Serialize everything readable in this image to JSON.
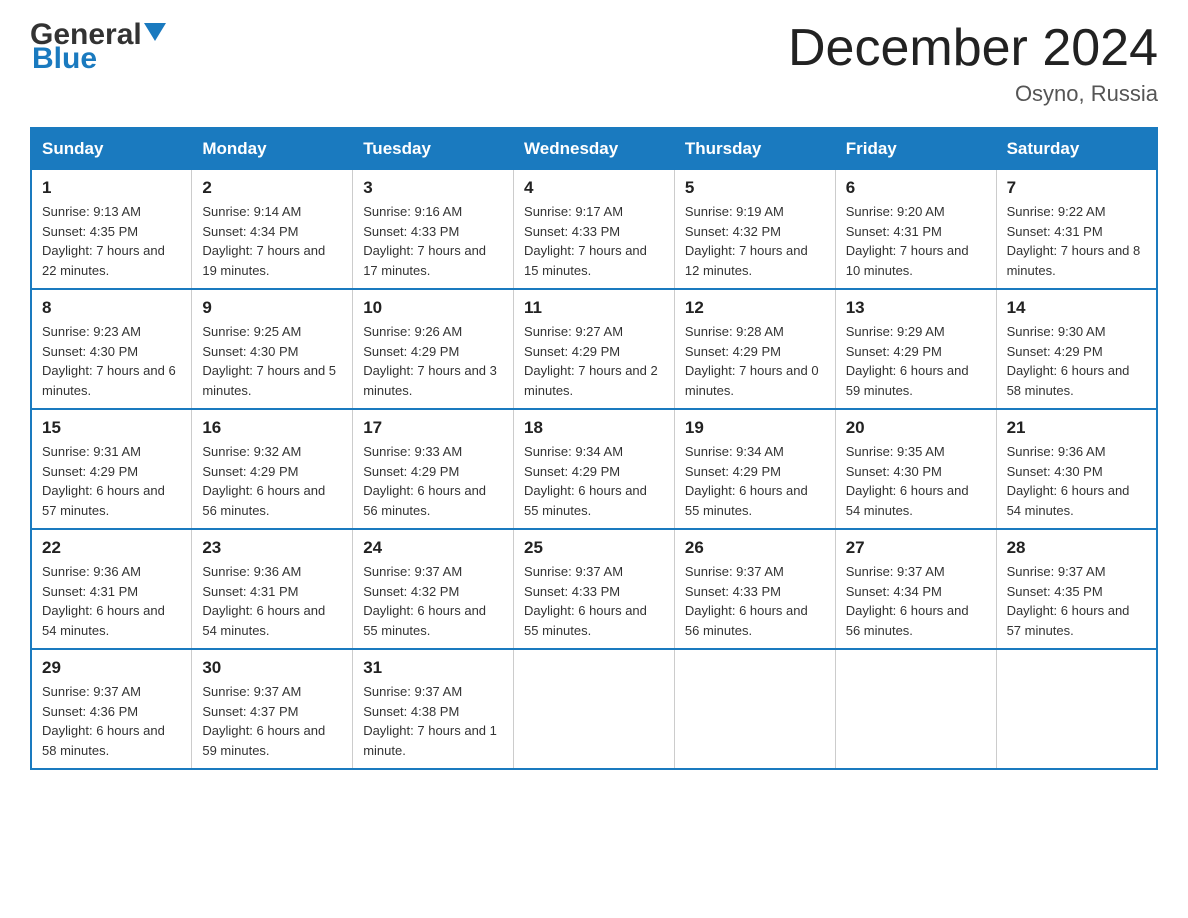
{
  "header": {
    "logo_general": "General",
    "logo_blue": "Blue",
    "month_title": "December 2024",
    "location": "Osyno, Russia"
  },
  "days_of_week": [
    "Sunday",
    "Monday",
    "Tuesday",
    "Wednesday",
    "Thursday",
    "Friday",
    "Saturday"
  ],
  "weeks": [
    [
      {
        "day": "1",
        "sunrise": "9:13 AM",
        "sunset": "4:35 PM",
        "daylight": "7 hours and 22 minutes."
      },
      {
        "day": "2",
        "sunrise": "9:14 AM",
        "sunset": "4:34 PM",
        "daylight": "7 hours and 19 minutes."
      },
      {
        "day": "3",
        "sunrise": "9:16 AM",
        "sunset": "4:33 PM",
        "daylight": "7 hours and 17 minutes."
      },
      {
        "day": "4",
        "sunrise": "9:17 AM",
        "sunset": "4:33 PM",
        "daylight": "7 hours and 15 minutes."
      },
      {
        "day": "5",
        "sunrise": "9:19 AM",
        "sunset": "4:32 PM",
        "daylight": "7 hours and 12 minutes."
      },
      {
        "day": "6",
        "sunrise": "9:20 AM",
        "sunset": "4:31 PM",
        "daylight": "7 hours and 10 minutes."
      },
      {
        "day": "7",
        "sunrise": "9:22 AM",
        "sunset": "4:31 PM",
        "daylight": "7 hours and 8 minutes."
      }
    ],
    [
      {
        "day": "8",
        "sunrise": "9:23 AM",
        "sunset": "4:30 PM",
        "daylight": "7 hours and 6 minutes."
      },
      {
        "day": "9",
        "sunrise": "9:25 AM",
        "sunset": "4:30 PM",
        "daylight": "7 hours and 5 minutes."
      },
      {
        "day": "10",
        "sunrise": "9:26 AM",
        "sunset": "4:29 PM",
        "daylight": "7 hours and 3 minutes."
      },
      {
        "day": "11",
        "sunrise": "9:27 AM",
        "sunset": "4:29 PM",
        "daylight": "7 hours and 2 minutes."
      },
      {
        "day": "12",
        "sunrise": "9:28 AM",
        "sunset": "4:29 PM",
        "daylight": "7 hours and 0 minutes."
      },
      {
        "day": "13",
        "sunrise": "9:29 AM",
        "sunset": "4:29 PM",
        "daylight": "6 hours and 59 minutes."
      },
      {
        "day": "14",
        "sunrise": "9:30 AM",
        "sunset": "4:29 PM",
        "daylight": "6 hours and 58 minutes."
      }
    ],
    [
      {
        "day": "15",
        "sunrise": "9:31 AM",
        "sunset": "4:29 PM",
        "daylight": "6 hours and 57 minutes."
      },
      {
        "day": "16",
        "sunrise": "9:32 AM",
        "sunset": "4:29 PM",
        "daylight": "6 hours and 56 minutes."
      },
      {
        "day": "17",
        "sunrise": "9:33 AM",
        "sunset": "4:29 PM",
        "daylight": "6 hours and 56 minutes."
      },
      {
        "day": "18",
        "sunrise": "9:34 AM",
        "sunset": "4:29 PM",
        "daylight": "6 hours and 55 minutes."
      },
      {
        "day": "19",
        "sunrise": "9:34 AM",
        "sunset": "4:29 PM",
        "daylight": "6 hours and 55 minutes."
      },
      {
        "day": "20",
        "sunrise": "9:35 AM",
        "sunset": "4:30 PM",
        "daylight": "6 hours and 54 minutes."
      },
      {
        "day": "21",
        "sunrise": "9:36 AM",
        "sunset": "4:30 PM",
        "daylight": "6 hours and 54 minutes."
      }
    ],
    [
      {
        "day": "22",
        "sunrise": "9:36 AM",
        "sunset": "4:31 PM",
        "daylight": "6 hours and 54 minutes."
      },
      {
        "day": "23",
        "sunrise": "9:36 AM",
        "sunset": "4:31 PM",
        "daylight": "6 hours and 54 minutes."
      },
      {
        "day": "24",
        "sunrise": "9:37 AM",
        "sunset": "4:32 PM",
        "daylight": "6 hours and 55 minutes."
      },
      {
        "day": "25",
        "sunrise": "9:37 AM",
        "sunset": "4:33 PM",
        "daylight": "6 hours and 55 minutes."
      },
      {
        "day": "26",
        "sunrise": "9:37 AM",
        "sunset": "4:33 PM",
        "daylight": "6 hours and 56 minutes."
      },
      {
        "day": "27",
        "sunrise": "9:37 AM",
        "sunset": "4:34 PM",
        "daylight": "6 hours and 56 minutes."
      },
      {
        "day": "28",
        "sunrise": "9:37 AM",
        "sunset": "4:35 PM",
        "daylight": "6 hours and 57 minutes."
      }
    ],
    [
      {
        "day": "29",
        "sunrise": "9:37 AM",
        "sunset": "4:36 PM",
        "daylight": "6 hours and 58 minutes."
      },
      {
        "day": "30",
        "sunrise": "9:37 AM",
        "sunset": "4:37 PM",
        "daylight": "6 hours and 59 minutes."
      },
      {
        "day": "31",
        "sunrise": "9:37 AM",
        "sunset": "4:38 PM",
        "daylight": "7 hours and 1 minute."
      },
      null,
      null,
      null,
      null
    ]
  ]
}
